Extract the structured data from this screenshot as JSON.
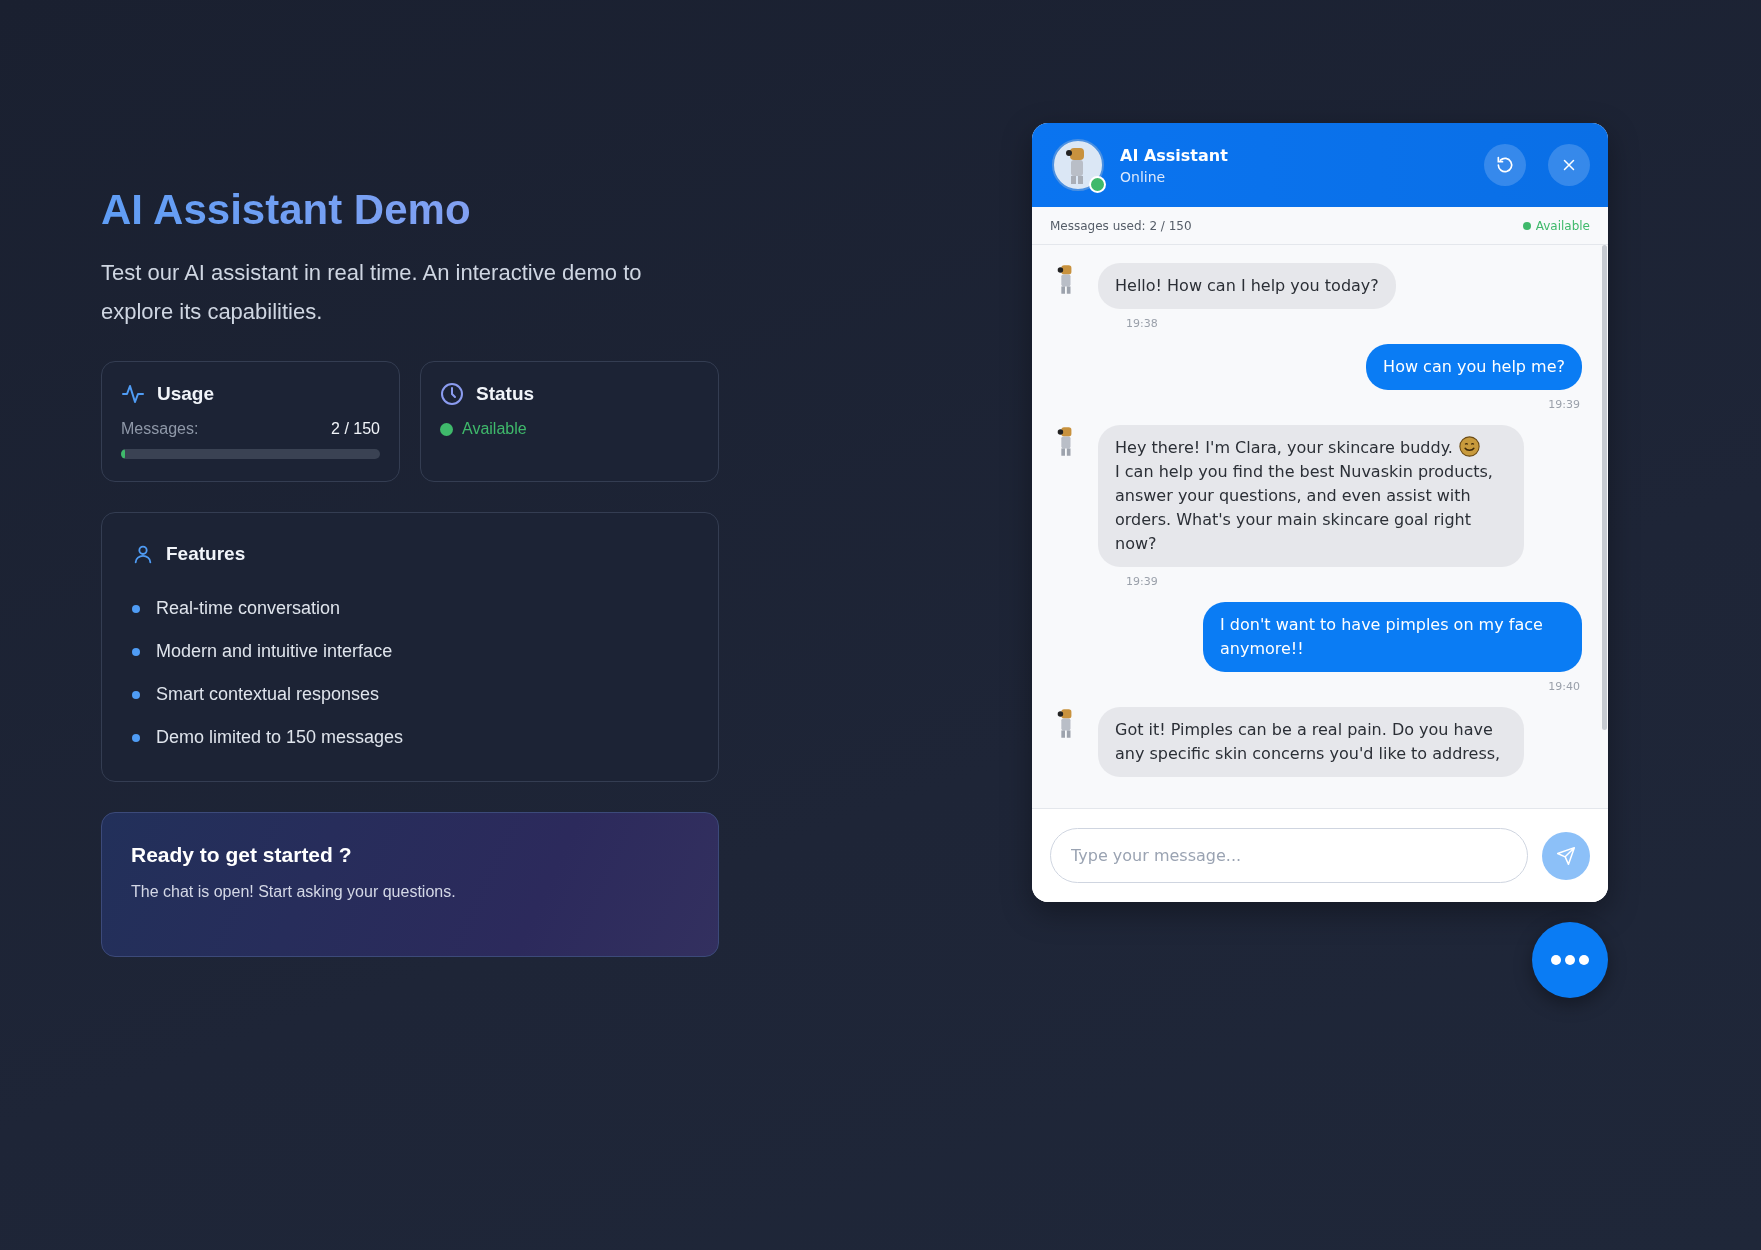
{
  "intro": {
    "title": "AI Assistant Demo",
    "description": "Test our AI assistant in real time. An interactive demo to explore its capabilities."
  },
  "usage_card": {
    "title": "Usage",
    "label": "Messages:",
    "value": "2 / 150",
    "level": 0.013
  },
  "status_card": {
    "title": "Status",
    "status": "Available",
    "color": "#3fb96b"
  },
  "features": {
    "title": "Features",
    "items": [
      "Real-time conversation",
      "Modern and intuitive interface",
      "Smart contextual responses",
      "Demo limited to 150 messages"
    ]
  },
  "cta": {
    "title": "Ready to get started ?",
    "text": "The chat is open! Start asking your questions."
  },
  "chat": {
    "title": "AI Assistant",
    "subtitle": "Online",
    "online": true,
    "info_bar": {
      "usage": "Messages used: 2 / 150",
      "status": "Available",
      "color": "#3fb96b"
    },
    "messages": [
      {
        "kind": "bot",
        "parts": [
          "Hello! How can I help you today?"
        ],
        "time": "19:38"
      },
      {
        "kind": "user",
        "parts": [
          "How can you help me?"
        ],
        "time": "19:39"
      },
      {
        "kind": "bot",
        "parts": [
          "Hey there! I'm Clara, your skincare buddy.",
          "I can help you find the best Nuvaskin products, answer your questions, and even assist with orders. What's your main skincare goal right now?"
        ],
        "emoji": true,
        "time": "19:39"
      },
      {
        "kind": "user",
        "parts": [
          "I don't want to have pimples on my face anymore!!"
        ],
        "time": "19:40"
      },
      {
        "kind": "bot",
        "parts": [
          "Got it! Pimples can be a real pain. Do you have any specific skin concerns you'd like to address,"
        ]
      }
    ],
    "input": {
      "placeholder": "Type your message..."
    }
  }
}
